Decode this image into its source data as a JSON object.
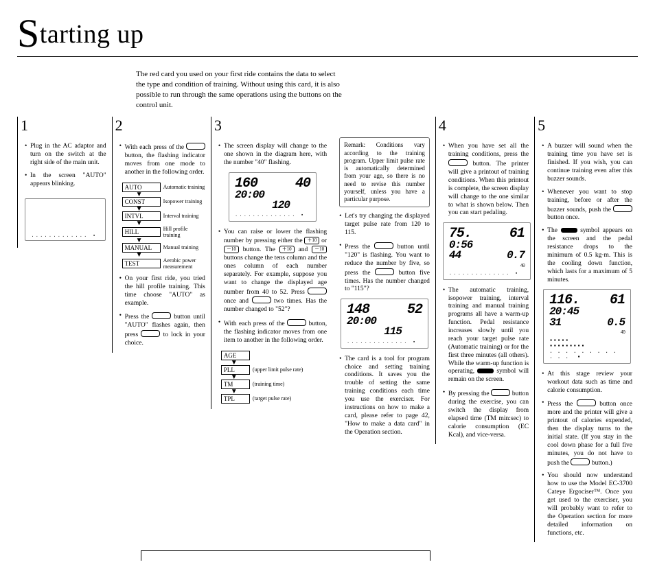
{
  "title_word": "tarting up",
  "intro": "The red card you used on your first ride contains the data to select the type and condition of training. Without using this card, it is also possible to run through the same operations using the buttons on the control unit.",
  "numbers": [
    "1",
    "2",
    "3",
    "4",
    "5"
  ],
  "col1": {
    "b1": "Plug in the AC adaptor and turn on the switch at the right side of the main unit.",
    "b2": "In the screen \"AUTO\" appears blinking."
  },
  "col2": {
    "b1a": "With each press of the ",
    "b1b": " button, the flashing indicator moves from one mode to another in the following order.",
    "modes": [
      {
        "code": "AUTO",
        "desc": "Automatic training"
      },
      {
        "code": "CONST",
        "desc": "Isopower training"
      },
      {
        "code": "INTVL",
        "desc": "Interval training"
      },
      {
        "code": "HILL",
        "desc": "Hill profile training"
      },
      {
        "code": "MANUAL",
        "desc": "Manual training"
      },
      {
        "code": "TEST",
        "desc": "Aerobic power measurement"
      }
    ],
    "b2": "On your first ride, you tried the hill profile training. This time choose \"AUTO\" as example.",
    "b3a": "Press the ",
    "b3b": " button until \"AUTO\" flashes again, then press ",
    "b3c": " to lock in your choice."
  },
  "col3": {
    "b1": "The screen display will change to the one shown in the diagram here, with the number \"40\" flashing.",
    "lcd1": {
      "r1a": "160",
      "r1b": "40",
      "r2": "20:00",
      "r3": "120"
    },
    "b2a": "You can raise or lower the flashing number by pressing either the ",
    "pill1": "＋10",
    "b2b": " or ",
    "pill2": "－10",
    "b2c": " button. The ",
    "pill3": "＋10",
    "b2d": " and ",
    "pill4": "－10",
    "b2e": " buttons change the tens column and the ones column of each number separately. For example, suppose you want to change the displayed age number from 40 to 52. Press ",
    "b2f": " once and ",
    "b2g": " two times. Has the number changed to \"52\"?",
    "b3a": "With each press of the ",
    "b3b": " button, the flashing indicator moves from one item to another in the following order.",
    "ages": [
      {
        "code": "AGE",
        "desc": ""
      },
      {
        "code": "PLL",
        "desc": "(upper limit pulse rate)"
      },
      {
        "code": "TM",
        "desc": "(training time)"
      },
      {
        "code": "TPL",
        "desc": "(target pulse rate)"
      }
    ]
  },
  "col4": {
    "remark": "Remark: Conditions vary according to the training program.\nUpper limit pulse rate is automatically determined from your age, so there is no need to revise this number yourself, unless you have a particular purpose.",
    "b1a": "Let's try changing the displayed target pulse rate from 120 to 115.",
    "b2a": "Press the ",
    "b2b": " button until \"120\" is flashing. You want to reduce the number by five, so press the ",
    "b2c": " button five times. Has the number changed to \"115\"?",
    "lcd2": {
      "r1a": "148",
      "r1b": "52",
      "r2": "20:00",
      "r3": "115"
    },
    "b3": "The card is a tool for program choice and setting training conditions. It saves you the trouble of setting the same training conditions each time you use the exerciser. For instructions on how to make a card, please refer to page 42, \"How to make a data card\" in the Operation section."
  },
  "col5": {
    "b1a": "When you have set all the training conditions, press the ",
    "b1b": " button. The printer will give a printout of training conditions. When this printout is complete, the screen display will change to the one similar to what is shown below. Then you can start pedaling.",
    "lcd3": {
      "r1a": "75.",
      "r1b": "61",
      "r2": "0:56",
      "r3a": "44",
      "r3b": "0.7",
      "r4": "40"
    },
    "b2a": "The automatic training, isopower training, interval training and manual training programs all have a warm-up function. Pedal resistance increases slowly until you reach your target pulse rate (Automatic training) or for the first three minutes (all others). While the warm-up function is operating, ",
    "b2b": " symbol will remain on the screen.",
    "b3a": "By pressing the ",
    "b3b": " button during the exercise, you can switch the display from elapsed time (TM min:sec) to calorie consumption (EC Kcal), and vice-versa."
  },
  "col6": {
    "b1": "A buzzer will sound when the training time you have set is finished. If you wish, you can continue training even after this buzzer sounds.",
    "b2a": "Whenever you want to stop training, before or after the buzzer sounds, push the ",
    "b2b": " button once.",
    "b3a": "The ",
    "b3b": " symbol appears on the screen and the pedal resistance drops to the minimum of 0.5 kg·m. This is the cooling down function, which lasts for a maximum of 5 minutes.",
    "lcd4": {
      "r1a": "116.",
      "r1b": "61",
      "r2": "20:45",
      "r3a": "31",
      "r3b": "0.5",
      "r4": "40"
    },
    "b4": "At this stage review your workout data such as time and calorie consumption.",
    "b5a": "Press the ",
    "b5b": " button once more and the printer will give a printout of calories expended, then the display turns to the initial state. (If you stay in the cool down phase for a full five minutes, you do not have to push the ",
    "b5c": " button.)",
    "b6": "You should now understand how to use the Model EC-3700 Cateye Ergociser™. Once you get used to the exerciser, you will probably want to refer to the Operation section for more detailed information on functions, etc."
  }
}
